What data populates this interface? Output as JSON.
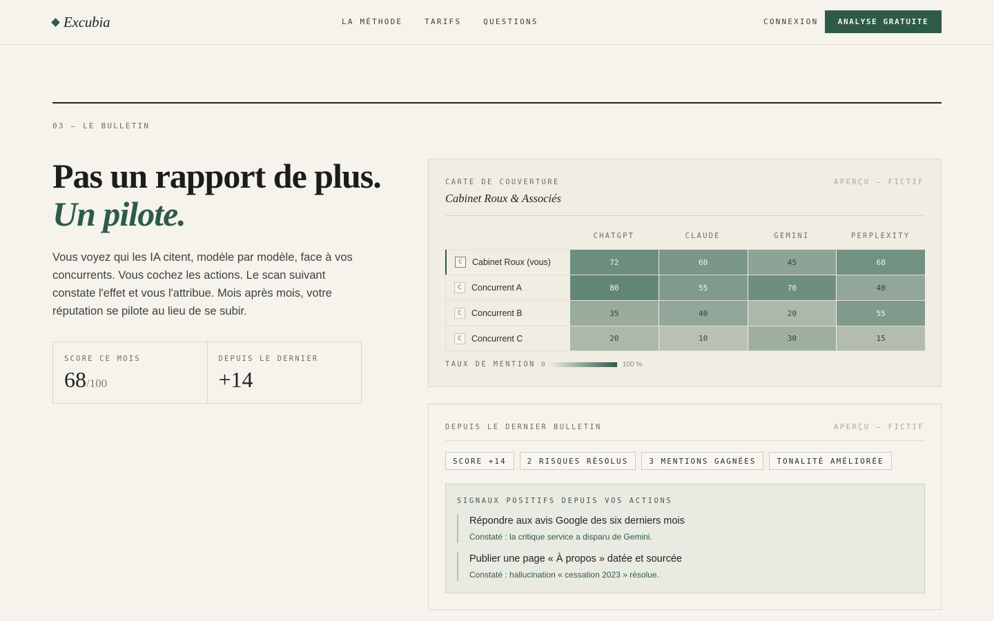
{
  "header": {
    "logo_text": "Excubia",
    "nav": [
      "LA MÉTHODE",
      "TARIFS",
      "QUESTIONS"
    ],
    "login_label": "CONNEXION",
    "cta_label": "ANALYSE GRATUITE"
  },
  "section": {
    "eyebrow": "03 — LE BULLETIN",
    "headline_line1": "Pas un rapport de plus.",
    "headline_line2": "Un pilote.",
    "lede": "Vous voyez qui les IA citent, modèle par modèle, face à vos concurrents. Vous cochez les actions. Le scan suivant constate l'effet et vous l'attribue. Mois après mois, votre réputation se pilote au lieu de se subir.",
    "stats": {
      "score_label": "SCORE CE MOIS",
      "score_value": "68",
      "score_denominator": "/100",
      "delta_label": "DEPUIS LE DERNIER",
      "delta_value": "+14"
    }
  },
  "coverage": {
    "eyebrow": "CARTE DE COUVERTURE",
    "tag": "APERÇU — FICTIF",
    "subtitle": "Cabinet Roux & Associés",
    "badge": "C",
    "columns": [
      "CHATGPT",
      "CLAUDE",
      "GEMINI",
      "PERPLEXITY"
    ],
    "rows": [
      {
        "name": "Cabinet Roux (vous)",
        "values": [
          "72",
          "60",
          "45",
          "68"
        ]
      },
      {
        "name": "Concurrent A",
        "values": [
          "80",
          "55",
          "70",
          "40"
        ]
      },
      {
        "name": "Concurrent B",
        "values": [
          "35",
          "40",
          "20",
          "55"
        ]
      },
      {
        "name": "Concurrent C",
        "values": [
          "20",
          "10",
          "30",
          "15"
        ]
      }
    ],
    "legend_label": "TAUX DE MENTION",
    "legend_min": "0",
    "legend_max": "100 %",
    "scale_low_color": "#eceae1",
    "scale_high_color": "#2e5a49"
  },
  "bulletin": {
    "eyebrow": "DEPUIS LE DERNIER BULLETIN",
    "tag": "APERÇU — FICTIF",
    "chips": [
      "SCORE +14",
      "2 RISQUES RÉSOLUS",
      "3 MENTIONS GAGNÉES",
      "TONALITÉ AMÉLIORÉE"
    ],
    "signals_title": "SIGNAUX POSITIFS DEPUIS VOS ACTIONS",
    "signals": [
      {
        "title": "Répondre aux avis Google des six derniers mois",
        "note": "Constaté : la critique service a disparu de Gemini."
      },
      {
        "title": "Publier une page « À propos » datée et sourcée",
        "note": "Constaté : hallucination « cessation 2023 » résolue."
      }
    ]
  },
  "colors": {
    "accent": "#2e5a49",
    "background": "#f5f3eb"
  }
}
